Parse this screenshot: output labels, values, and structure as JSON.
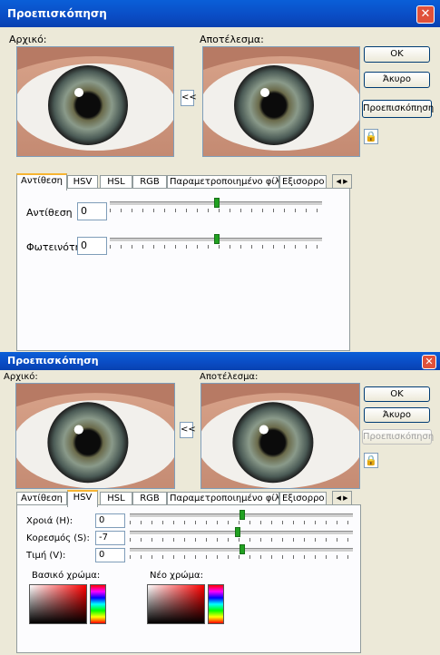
{
  "window1": {
    "title": "Προεπισκόπηση",
    "original_label": "Αρχικό:",
    "result_label": "Αποτέλεσμα:",
    "copy_button": "<<",
    "ok_button": "OK",
    "cancel_button": "Άκυρο",
    "preview_button": "Προεπισκόπηση",
    "tabs": [
      "Αντίθεση",
      "HSV",
      "HSL",
      "RGB",
      "Παραμετροποιημένο φίλτρο",
      "Εξισορρο"
    ],
    "active_tab": "Αντίθεση",
    "controls": [
      {
        "label": "Αντίθεση",
        "value": "0",
        "slider_level": 0.5
      },
      {
        "label": "Φωτεινότητ",
        "value": "0",
        "slider_level": 0.5
      }
    ]
  },
  "window2": {
    "title": "Προεπισκόπηση",
    "original_label": "Αρχικό:",
    "result_label": "Αποτέλεσμα:",
    "copy_button": "<<",
    "ok_button": "OK",
    "cancel_button": "Άκυρο",
    "preview_button": "Προεπισκόπηση",
    "preview_disabled": true,
    "tabs": [
      "Αντίθεση",
      "HSV",
      "HSL",
      "RGB",
      "Παραμετροποιημένο φίλτρο",
      "Εξισορρο"
    ],
    "active_tab": "HSV",
    "controls": [
      {
        "label": "Χροιά (H):",
        "value": "0",
        "slider_level": 0.5
      },
      {
        "label": "Κορεσμός (S):",
        "value": "-7",
        "slider_level": 0.48
      },
      {
        "label": "Τιμή (V):",
        "value": "0",
        "slider_level": 0.5
      }
    ],
    "base_color_label": "Βασικό χρώμα:",
    "new_color_label": "Νέο χρώμα:"
  },
  "icons": {
    "close": "close-icon",
    "lock": "lock-icon",
    "tab_scroll": "tab-scroll-arrows-icon"
  },
  "colors": {
    "titlebar": "#0a4cc4",
    "window_bg": "#ece9d8",
    "close_button": "#e0513a",
    "active_tab_accent": "#f7b431"
  }
}
